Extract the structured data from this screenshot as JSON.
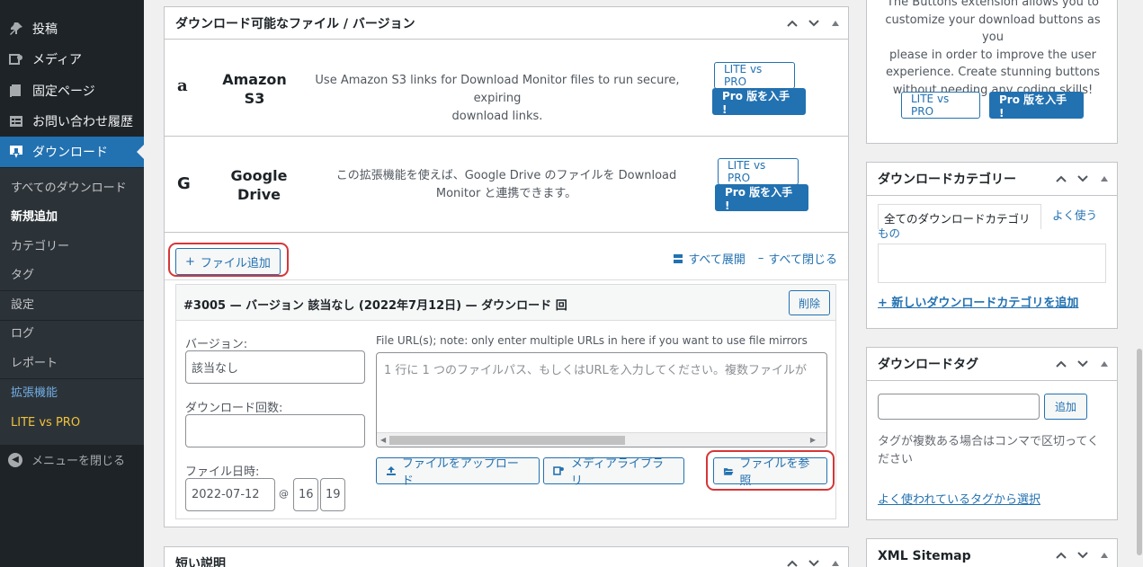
{
  "sidebar": {
    "items": [
      {
        "label": "投稿",
        "icon": "pin-icon"
      },
      {
        "label": "メディア",
        "icon": "media-icon"
      },
      {
        "label": "固定ページ",
        "icon": "page-icon"
      },
      {
        "label": "お問い合わせ履歴",
        "icon": "inbox-icon"
      },
      {
        "label": "ダウンロード",
        "icon": "download-icon"
      }
    ],
    "submenu": [
      "すべてのダウンロード",
      "新規追加",
      "カテゴリー",
      "タグ",
      "設定",
      "ログ",
      "レポート",
      "拡張機能",
      "LITE vs PRO"
    ],
    "collapse_label": "メニューを閉じる"
  },
  "files_box": {
    "title": "ダウンロード可能なファイル / バージョン",
    "extensions": [
      {
        "logo": "a",
        "name_line1": "Amazon",
        "name_line2": "S3",
        "desc_line1": "Use Amazon S3 links for Download Monitor files to run secure, expiring",
        "desc_line2": "download links.",
        "compare_label": "LITE vs PRO",
        "pro_label": "Pro 版を入手 !"
      },
      {
        "logo": "G",
        "name_line1": "Google",
        "name_line2": "Drive",
        "desc_line1": "この拡張機能を使えば、Google Drive のファイルを Download",
        "desc_line2": "Monitor と連携できます。",
        "compare_label": "LITE vs PRO",
        "pro_label": "Pro 版を入手 !"
      }
    ],
    "add_file_label": "ファイル追加",
    "expand_all": "すべて展開",
    "collapse_all": "すべて閉じる",
    "version": {
      "title": "#3005 — バージョン 該当なし (2022年7月12日) — ダウンロード 回",
      "delete_label": "削除",
      "version_label": "バージョン:",
      "version_value": "該当なし",
      "download_count_label": "ダウンロード回数:",
      "download_count_value": "",
      "file_date_label": "ファイル日時:",
      "file_date_value": "2022-07-12",
      "at_sign": "@",
      "hour": "16",
      "minute": "19",
      "url_label": "File URL(s); note: only enter multiple URLs in here if you want to use file mirrors",
      "url_placeholder": "1 行に 1 つのファイルパス、もしくはURLを入力してください。複数ファイルが",
      "upload_label": "ファイルをアップロード",
      "media_label": "メディアライブラリ",
      "browse_label": "ファイルを参照"
    }
  },
  "short_desc_box": {
    "title": "短い説明"
  },
  "buttons_promo": {
    "lines": [
      "The Buttons extension allows you to",
      "customize your download buttons as you",
      "please in order to improve the user",
      "experience. Create stunning buttons",
      "without needing any coding skills!"
    ],
    "compare_label": "LITE vs PRO",
    "pro_label": "Pro 版を入手 !"
  },
  "category_box": {
    "title": "ダウンロードカテゴリー",
    "tab_all": "全てのダウンロードカテゴリ",
    "tab_popular_line1": "よく使う",
    "tab_popular_line2": "もの",
    "add_new": "+ 新しいダウンロードカテゴリを追加"
  },
  "tag_box": {
    "title": "ダウンロードタグ",
    "tag_input_value": "",
    "add_label": "追加",
    "help_line1": "タグが複数ある場合はコンマで区切ってく",
    "help_line2": "ださい",
    "popular_link": "よく使われているタグから選択"
  },
  "sitemap_box": {
    "title": "XML Sitemap"
  },
  "colors": {
    "accent": "#2271b1",
    "sidebar": "#1d2327",
    "highlight": "#d63638"
  }
}
